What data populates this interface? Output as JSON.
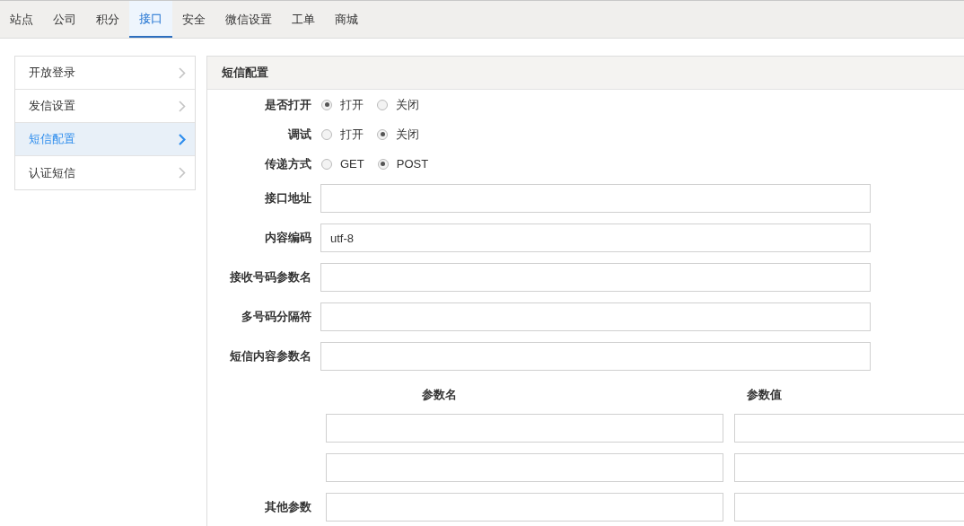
{
  "tabs": [
    {
      "label": "站点",
      "selected": false
    },
    {
      "label": "公司",
      "selected": false
    },
    {
      "label": "积分",
      "selected": false
    },
    {
      "label": "接口",
      "selected": true
    },
    {
      "label": "安全",
      "selected": false
    },
    {
      "label": "微信设置",
      "selected": false
    },
    {
      "label": "工单",
      "selected": false
    },
    {
      "label": "商城",
      "selected": false
    }
  ],
  "sidebar": {
    "items": [
      {
        "label": "开放登录",
        "selected": false
      },
      {
        "label": "发信设置",
        "selected": false
      },
      {
        "label": "短信配置",
        "selected": true
      },
      {
        "label": "认证短信",
        "selected": false
      }
    ]
  },
  "panel": {
    "title": "短信配置",
    "radio_fields": [
      {
        "label": "是否打开",
        "options": [
          {
            "label": "打开",
            "selected": true
          },
          {
            "label": "关闭",
            "selected": false
          }
        ]
      },
      {
        "label": "调试",
        "options": [
          {
            "label": "打开",
            "selected": false
          },
          {
            "label": "关闭",
            "selected": true
          }
        ]
      },
      {
        "label": "传递方式",
        "options": [
          {
            "label": "GET",
            "selected": false
          },
          {
            "label": "POST",
            "selected": true
          }
        ]
      }
    ],
    "text_fields": [
      {
        "label": "接口地址"
      },
      {
        "label": "内容编码",
        "value": "utf-8"
      },
      {
        "label": "接收号码参数名"
      },
      {
        "label": "多号码分隔符"
      },
      {
        "label": "短信内容参数名"
      }
    ],
    "other_params": {
      "columns": [
        "参数名",
        "参数值"
      ],
      "rows": [
        {
          "kind": "pair"
        },
        {
          "kind": "pair"
        },
        {
          "kind": "pair",
          "label": "其他参数"
        }
      ]
    }
  }
}
